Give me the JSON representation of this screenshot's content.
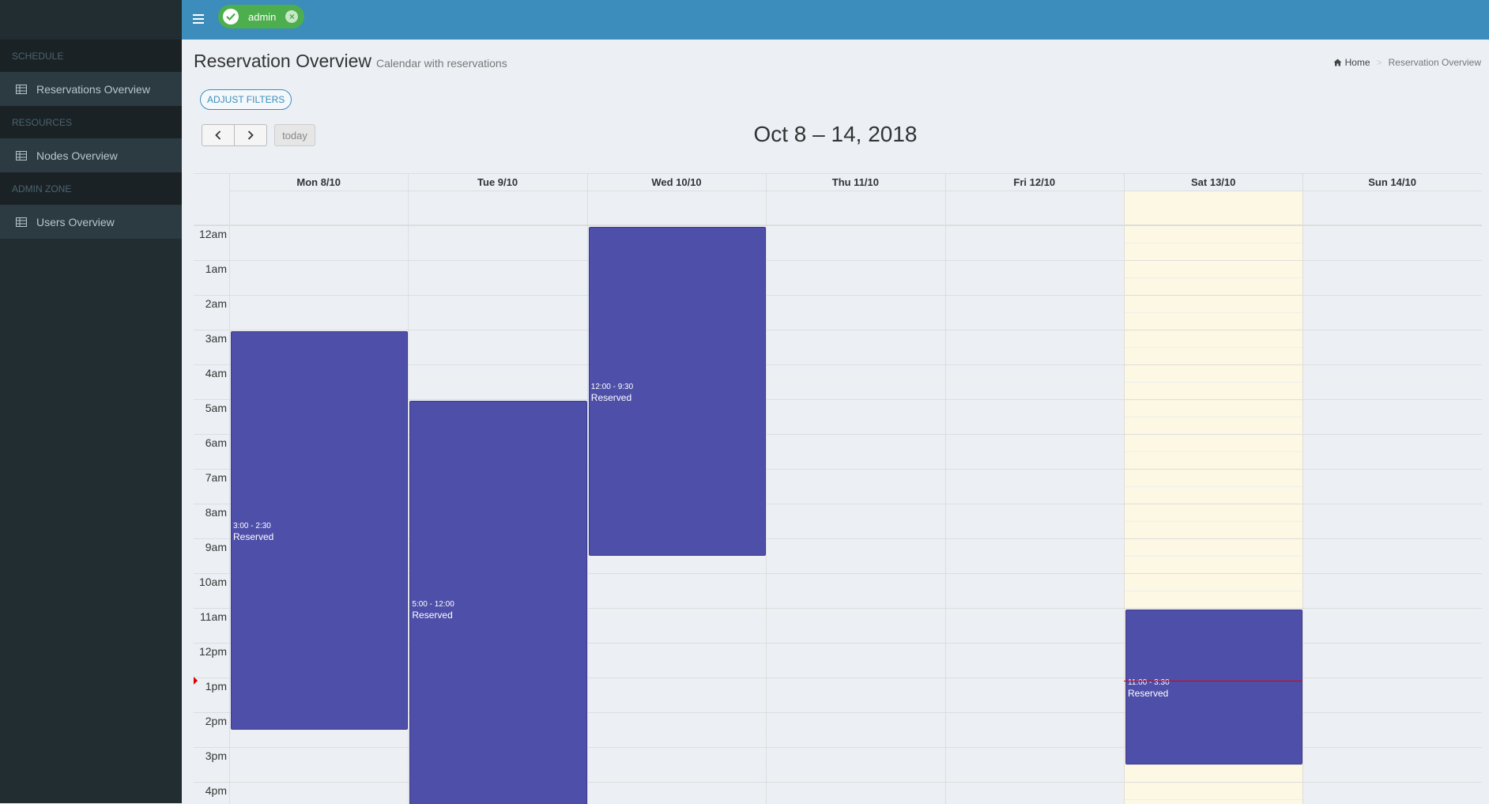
{
  "sidebar": {
    "sections": [
      {
        "header": "SCHEDULE",
        "items": [
          {
            "label": "Reservations Overview",
            "icon": "table-icon"
          }
        ]
      },
      {
        "header": "RESOURCES",
        "items": [
          {
            "label": "Nodes Overview",
            "icon": "table-icon"
          }
        ]
      },
      {
        "header": "ADMIN ZONE",
        "items": [
          {
            "label": "Users Overview",
            "icon": "table-icon"
          }
        ]
      }
    ]
  },
  "header": {
    "user_chip": {
      "label": "admin",
      "icon": "check-circle-icon",
      "close_icon": "close-circle-icon"
    },
    "menu_icon": "hamburger-icon",
    "color": "#3c8dbc"
  },
  "page": {
    "title": "Reservation Overview",
    "subtitle": "Calendar with reservations",
    "breadcrumb": {
      "home": "Home",
      "current": "Reservation Overview",
      "home_icon": "home-icon"
    },
    "filter_button": "ADJUST FILTERS"
  },
  "calendar": {
    "range_title": "Oct 8 – 14, 2018",
    "prev_icon": "chevron-left-icon",
    "next_icon": "chevron-right-icon",
    "today_label": "today",
    "days": [
      "Mon 8/10",
      "Tue 9/10",
      "Wed 10/10",
      "Thu 11/10",
      "Fri 12/10",
      "Sat 13/10",
      "Sun 14/10"
    ],
    "today_index": 5,
    "hours": [
      "12am",
      "1am",
      "2am",
      "3am",
      "4am",
      "5am",
      "6am",
      "7am",
      "8am",
      "9am",
      "10am",
      "11am",
      "12pm",
      "1pm",
      "2pm",
      "3pm",
      "4pm"
    ],
    "now_hour": 13.1,
    "event_color": "#4e4fa9",
    "events": [
      {
        "day": 0,
        "time": "3:00 - 2:30",
        "title": "Reserved",
        "start": 3.0,
        "end": 14.5
      },
      {
        "day": 1,
        "time": "5:00 - 12:00",
        "title": "Reserved",
        "start": 5.0,
        "end": 17.0
      },
      {
        "day": 2,
        "time": "12:00 - 9:30",
        "title": "Reserved",
        "start": 0.0,
        "end": 9.5
      },
      {
        "day": 5,
        "time": "11:00 - 3:30",
        "title": "Reserved",
        "start": 11.0,
        "end": 15.5
      }
    ]
  }
}
